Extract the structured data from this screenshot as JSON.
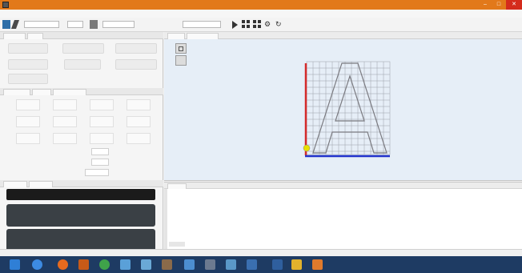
{
  "window": {
    "title": "",
    "minimize_icon": "minimize-icon",
    "maximize_icon": "maximize-icon",
    "close_icon": "close-icon"
  },
  "menu": [
    "",
    "",
    "",
    "",
    "",
    "",
    ""
  ],
  "toolbar": {
    "file_field": "",
    "zoom_field": "",
    "mode_field": "",
    "icons": [
      "open-icon",
      "save-icon",
      "play-icon",
      "pause-icon",
      "grid-icon",
      "grid-icon",
      "settings-icon",
      "reset-icon"
    ]
  },
  "left_panel": {
    "tabs": [
      "",
      ""
    ],
    "buttons": [
      "",
      "",
      "",
      "",
      "",
      "",
      ""
    ],
    "jog_tabs": [
      "",
      "",
      ""
    ],
    "jog_cells": [
      "",
      "",
      "",
      "",
      "",
      "",
      "",
      "",
      "",
      "",
      "",
      "",
      "",
      "",
      "",
      ""
    ],
    "step_fields": [
      {
        "label": "",
        "value": "",
        "extra": ""
      },
      {
        "label": "",
        "value": "",
        "extra": ""
      },
      {
        "label": "",
        "value": "",
        "extra": ""
      }
    ],
    "lower_tabs": [
      "",
      ""
    ],
    "dro_header_value": "",
    "dro": [
      {
        "axis": "",
        "value_1": "",
        "value_2": ""
      },
      {
        "axis": "",
        "value_1": "",
        "value_2": ""
      }
    ]
  },
  "visualizer": {
    "tabs": [
      "",
      ""
    ],
    "axis_x_label": "",
    "axis_y_label": "",
    "center_label": "",
    "shape_glyph": "A",
    "colors": {
      "y_axis": "#d42a2a",
      "x_axis": "#2233cc",
      "origin": "#e8e000",
      "grid": "#9aa0a8"
    }
  },
  "console": {
    "tab": "",
    "status_right": ""
  },
  "statusbar": {
    "items": [
      "",
      "",
      ""
    ]
  },
  "taskbar": {
    "icons": [
      "windows-start-icon",
      "edge-browser-icon",
      "firefox-icon",
      "mail-icon",
      "chrome-icon",
      "app-icon",
      "app-icon",
      "app-icon",
      "app-icon",
      "app-icon",
      "app-icon",
      "app-icon",
      "app-icon",
      "app-icon",
      "app-icon"
    ],
    "clock": ""
  }
}
